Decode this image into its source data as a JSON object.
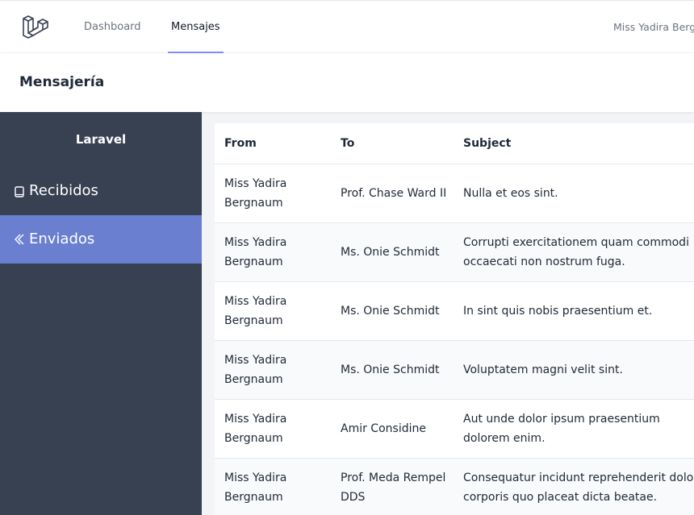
{
  "nav": {
    "links": [
      "Dashboard",
      "Mensajes"
    ],
    "user": "Miss Yadira Bergnaum"
  },
  "header": {
    "title": "Mensajería"
  },
  "sidebar": {
    "title": "Laravel",
    "items": [
      {
        "label": "Recibidos",
        "icon": "book-icon"
      },
      {
        "label": "Enviados",
        "icon": "reply-icon"
      }
    ]
  },
  "table": {
    "columns": [
      "From",
      "To",
      "Subject"
    ],
    "rows": [
      {
        "from": "Miss Yadira Bergnaum",
        "to": "Prof. Chase Ward II",
        "subject": "Nulla et eos sint."
      },
      {
        "from": "Miss Yadira Bergnaum",
        "to": "Ms. Onie Schmidt",
        "subject": "Corrupti exercitationem quam commodi occaecati non nostrum fuga."
      },
      {
        "from": "Miss Yadira Bergnaum",
        "to": "Ms. Onie Schmidt",
        "subject": "In sint quis nobis praesentium et."
      },
      {
        "from": "Miss Yadira Bergnaum",
        "to": "Ms. Onie Schmidt",
        "subject": "Voluptatem magni velit sint."
      },
      {
        "from": "Miss Yadira Bergnaum",
        "to": "Amir Considine",
        "subject": "Aut unde dolor ipsum praesentium dolorem enim."
      },
      {
        "from": "Miss Yadira Bergnaum",
        "to": "Prof. Meda Rempel DDS",
        "subject": "Consequatur incidunt reprehenderit dolor corporis quo placeat dicta beatae."
      }
    ]
  },
  "colors": {
    "accent": "#818cf8",
    "sidebar": "#374151",
    "active_item": "#6b7fd0"
  }
}
